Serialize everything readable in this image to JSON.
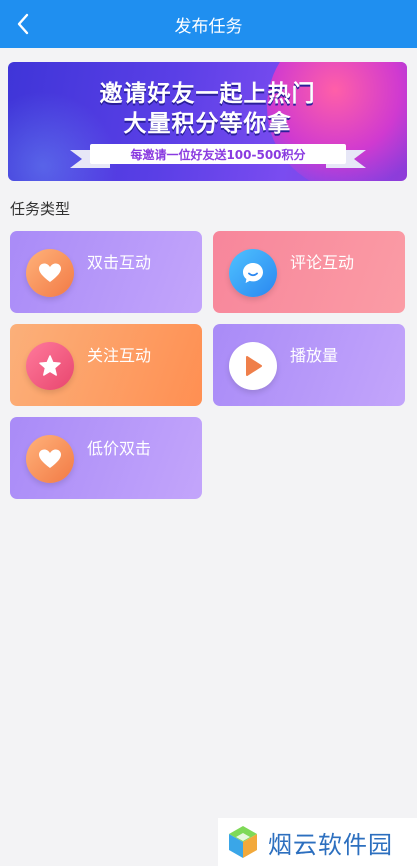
{
  "header": {
    "title": "发布任务"
  },
  "banner": {
    "line1": "邀请好友一起上热门",
    "line2": "大量积分等你拿",
    "ribbon": "每邀请一位好友送100-500积分"
  },
  "section_title": "任务类型",
  "tasks": [
    {
      "label": "双击互动",
      "icon": "heart-icon"
    },
    {
      "label": "评论互动",
      "icon": "comment-icon"
    },
    {
      "label": "关注互动",
      "icon": "star-icon"
    },
    {
      "label": "播放量",
      "icon": "play-icon"
    },
    {
      "label": "低价双击",
      "icon": "heart-icon"
    }
  ],
  "watermark": {
    "text": "烟云软件园"
  },
  "colors": {
    "header": "#1f8ff0",
    "purple_card": "#b198f9",
    "pink_card": "#f98fa0",
    "orange_card": "#fd9d62"
  }
}
